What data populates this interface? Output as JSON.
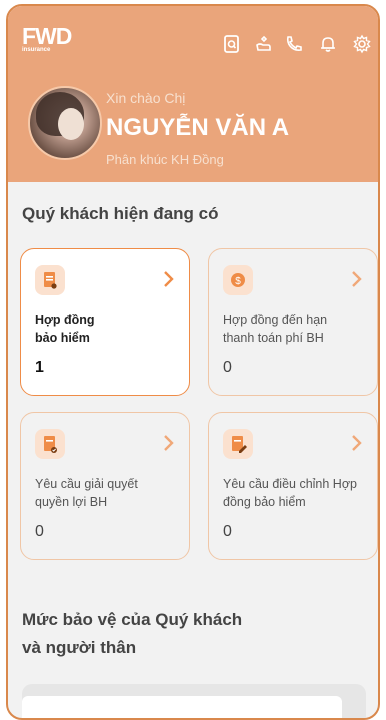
{
  "brand": {
    "logo_text": "FWD",
    "logo_sub": "insurance"
  },
  "header": {
    "greeting": "Xin chào Chị",
    "name": "NGUYỄN VĂN A",
    "segment": "Phân khúc KH Đồng",
    "icons": [
      "document-search-icon",
      "hand-heart-icon",
      "phone-icon",
      "bell-icon",
      "settings-icon"
    ]
  },
  "section1": {
    "title": "Quý khách hiện đang có"
  },
  "cards": [
    {
      "label": "Hợp đồng\nbảo hiểm",
      "value": "1",
      "icon": "contract-icon",
      "active": true
    },
    {
      "label": "Hợp đồng đến hạn\nthanh toán phí BH",
      "value": "0",
      "icon": "dollar-icon",
      "active": false
    },
    {
      "label": "Yêu cầu giải quyết\nquyền lợi BH",
      "value": "0",
      "icon": "claim-icon",
      "active": false
    },
    {
      "label": "Yêu cầu điều chỉnh Hợp\nđồng bảo hiểm",
      "value": "0",
      "icon": "edit-contract-icon",
      "active": false
    }
  ],
  "section2": {
    "title_line1": "Mức bảo vệ của Quý khách",
    "title_line2": "và người thân"
  },
  "colors": {
    "brand_orange": "#ef8c47",
    "header_bg": "#eaa57b"
  }
}
